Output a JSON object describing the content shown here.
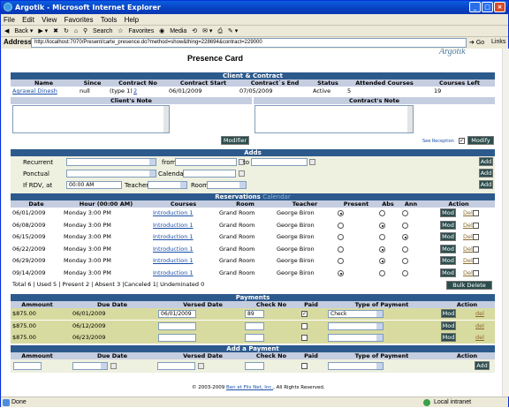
{
  "window": {
    "title": "Argotik - Microsoft Internet Explorer"
  },
  "menu": [
    "File",
    "Edit",
    "View",
    "Favorites",
    "Tools",
    "Help"
  ],
  "toolbar": {
    "back": "Back",
    "search": "Search",
    "favorites": "Favorites",
    "media": "Media"
  },
  "address": {
    "label": "Address",
    "url": "http://localhost:7070/Present/carte_presence.do?method=show&thing=228694&contract=229000",
    "go": "Go",
    "links": "Links"
  },
  "page": {
    "title": "Presence Card",
    "logo": "Argotik"
  },
  "client_contract": {
    "section": "Client & Contract",
    "headers": [
      "Name",
      "Since",
      "Contract No",
      "Contract Start",
      "Contract`s End",
      "Status",
      "Attended Courses",
      "Courses Left"
    ],
    "row": {
      "name": "Agrawal Dinesh",
      "since": "null",
      "contract_no_prefix": "(type 1)",
      "contract_no": "2",
      "start": "06/01/2009",
      "end": "07/05/2009",
      "status": "Active",
      "attended": "5",
      "left": "19"
    },
    "client_note_label": "Client's Note",
    "contract_note_label": "Contract's Note",
    "modify_left": "Modifier",
    "see_reception": "See Reception",
    "modify_right": "Modify"
  },
  "adds": {
    "section": "Adds",
    "recurrent": "Recurrent",
    "from": "from",
    "to": "to",
    "ponctual": "Ponctual",
    "calendar": "Calendar",
    "if_rdv": "If RDV, at",
    "time": "00:00 AM",
    "teacher": "Teacher",
    "room": "Room",
    "add": "Add"
  },
  "reservations": {
    "section": "Reservations",
    "calendar_link": "Calendar",
    "headers": [
      "Date",
      "Hour (00:00 AM)",
      "Courses",
      "Room",
      "Teacher",
      "Present",
      "Abs",
      "Ann",
      "Action"
    ],
    "rows": [
      {
        "date": "06/01/2009",
        "hour": "Monday 3:00 PM",
        "course": "Introduction 1",
        "room": "Grand Room",
        "teacher": "George Biron",
        "status": "present"
      },
      {
        "date": "06/08/2009",
        "hour": "Monday 3:00 PM",
        "course": "Introduction 1",
        "room": "Grand Room",
        "teacher": "George Biron",
        "status": "abs"
      },
      {
        "date": "06/15/2009",
        "hour": "Monday 3:00 PM",
        "course": "Introduction 1",
        "room": "Grand Room",
        "teacher": "George Biron",
        "status": "ann"
      },
      {
        "date": "06/22/2009",
        "hour": "Monday 3:00 PM",
        "course": "Introduction 1",
        "room": "Grand Room",
        "teacher": "George Biron",
        "status": "abs"
      },
      {
        "date": "06/29/2009",
        "hour": "Monday 3:00 PM",
        "course": "Introduction 1",
        "room": "Grand Room",
        "teacher": "George Biron",
        "status": "abs"
      },
      {
        "date": "09/14/2009",
        "hour": "Monday 3:00 PM",
        "course": "Introduction 1",
        "room": "Grand Room",
        "teacher": "George Biron",
        "status": "present"
      }
    ],
    "mod": "Mod",
    "del": "Del",
    "totals": "Total  6 | Used  5 | Present  2 | Absent  3 |Canceled  1| Undeminated  0",
    "bulk_delete": "Bulk Delete"
  },
  "payments": {
    "section": "Payments",
    "headers": [
      "Ammount",
      "Due Date",
      "Versed Date",
      "Check No",
      "Paid",
      "Type of Payment",
      "Action"
    ],
    "rows": [
      {
        "amount": "$875.00",
        "due": "06/01/2009",
        "versed": "06/01/2009",
        "check": "89",
        "paid": true,
        "type": "Check"
      },
      {
        "amount": "$875.00",
        "due": "06/12/2009",
        "versed": "",
        "check": "",
        "paid": false,
        "type": ""
      },
      {
        "amount": "$875.00",
        "due": "06/23/2009",
        "versed": "",
        "check": "",
        "paid": false,
        "type": ""
      }
    ],
    "mod": "Mod",
    "del": "del"
  },
  "add_payment": {
    "section": "Add a Payment",
    "headers": [
      "Ammount",
      "Due Date",
      "Versed Date",
      "Check No",
      "Paid",
      "Type of Payment",
      "Action"
    ],
    "add": "Add"
  },
  "footer": {
    "prefix": "© 2003-2009",
    "company": "Ben et Fils Net, Inc.",
    "suffix": ", All Rights Reserved."
  },
  "status": {
    "left": "Done",
    "zone": "Local intranet"
  }
}
